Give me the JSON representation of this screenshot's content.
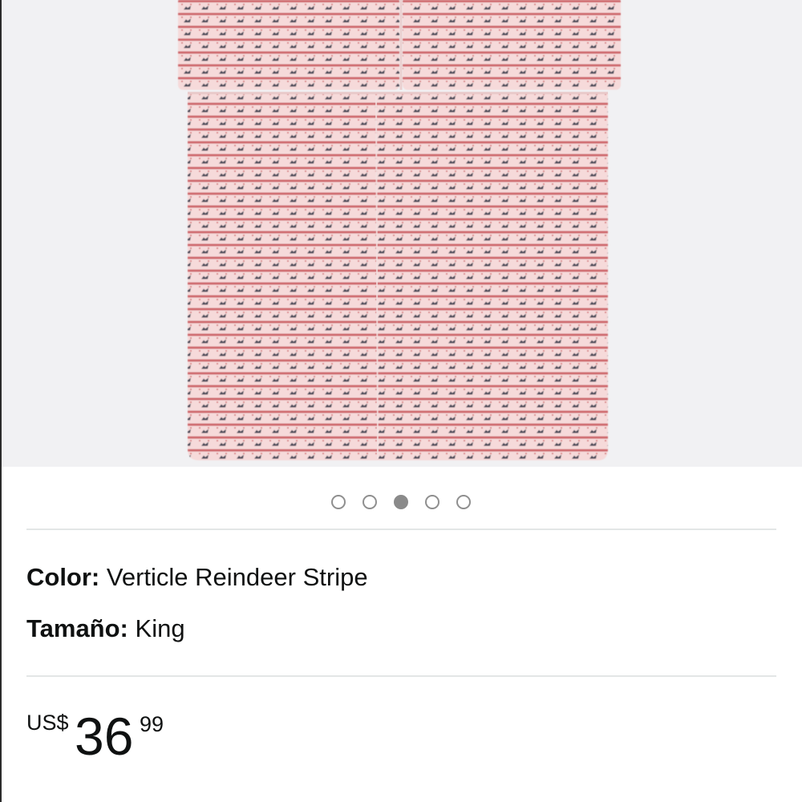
{
  "product_image": {
    "alt": "Verticle Reindeer Stripe King sheet set",
    "colors": {
      "background": "#f1f1f3",
      "fabric_base": "#f6dada",
      "stripe_red": "#cf6b6e",
      "reindeer": "#4a4a58"
    }
  },
  "carousel": {
    "dot_count": 5,
    "active_index": 2
  },
  "variations": {
    "color_label": "Color:",
    "color_value": "Verticle Reindeer Stripe",
    "size_label": "Tamaño:",
    "size_value": "King"
  },
  "price": {
    "symbol": "US$",
    "whole": "36",
    "fraction": "99"
  }
}
